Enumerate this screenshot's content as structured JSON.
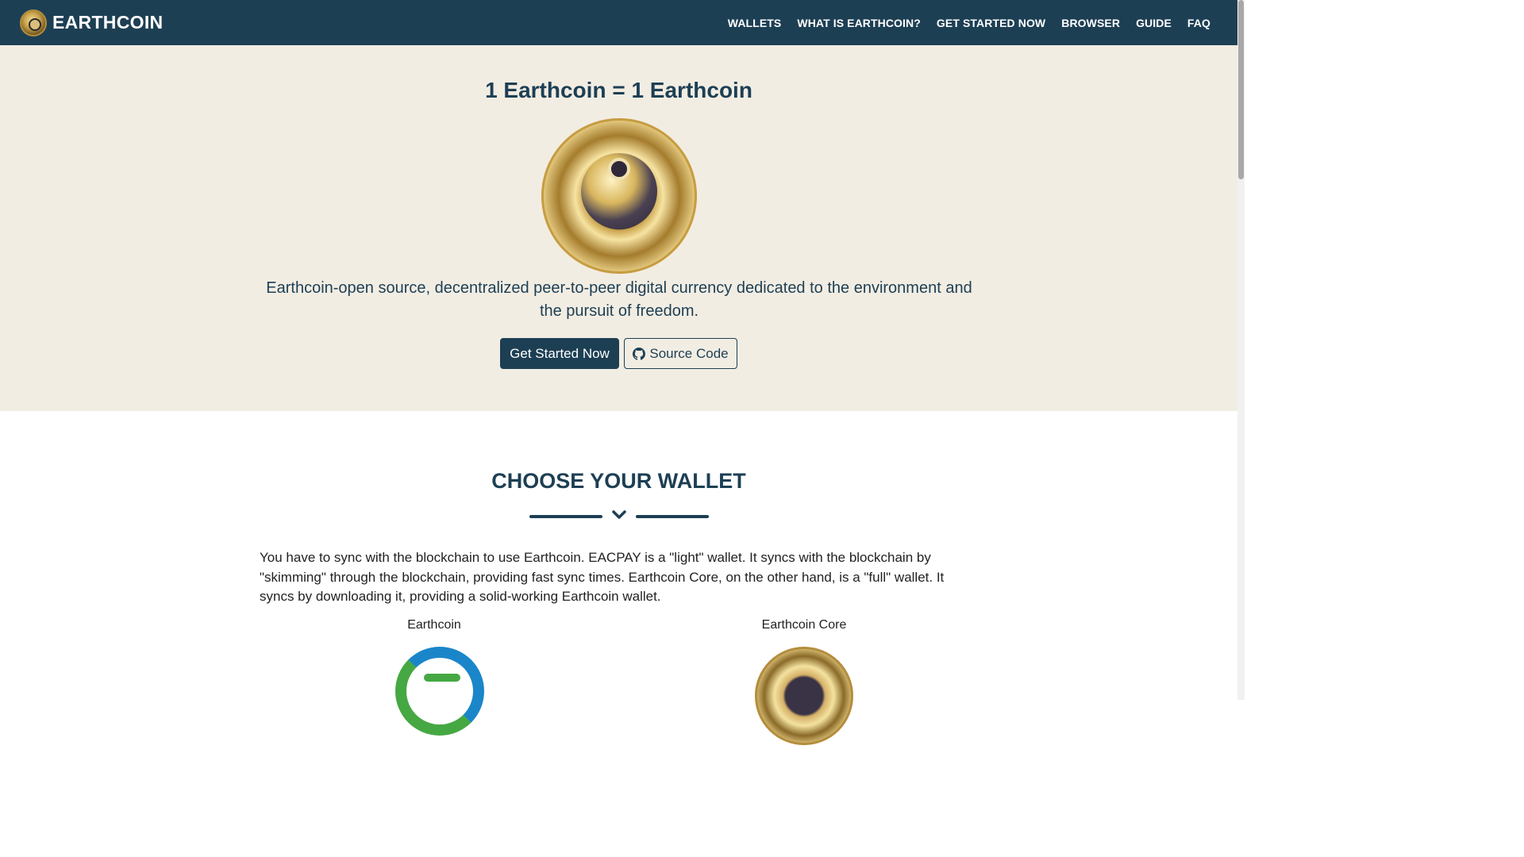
{
  "nav": {
    "brand": "EARTHCOIN",
    "links": [
      "WALLETS",
      "WHAT IS EARTHCOIN?",
      "GET STARTED NOW",
      "BROWSER",
      "GUIDE",
      "FAQ"
    ]
  },
  "hero": {
    "title": "1 Earthcoin = 1 Earthcoin",
    "coin_icon": "earthcoin-coin-icon",
    "description": "Earthcoin-open source, decentralized peer-to-peer digital currency dedicated to the environment and the pursuit of freedom.",
    "primary_button": "Get Started Now",
    "secondary_button": "Source Code",
    "secondary_icon": "github-icon"
  },
  "wallets": {
    "title": "CHOOSE YOUR WALLET",
    "description": "You have to sync with the blockchain to use Earthcoin. EACPAY is a \"light\" wallet. It syncs with the blockchain by \"skimming\" through the blockchain, providing fast sync times. Earthcoin Core, on the other hand, is a \"full\" wallet. It syncs by downloading it, providing a solid-working Earthcoin wallet.",
    "options": [
      {
        "name": "Earthcoin",
        "icon": "eacpay-logo-icon"
      },
      {
        "name": "Earthcoin Core",
        "icon": "earthcoin-core-coin-icon"
      }
    ]
  },
  "colors": {
    "nav_bg": "#1d3f54",
    "hero_bg": "#f2ede3",
    "text_primary": "#1d3f54"
  }
}
